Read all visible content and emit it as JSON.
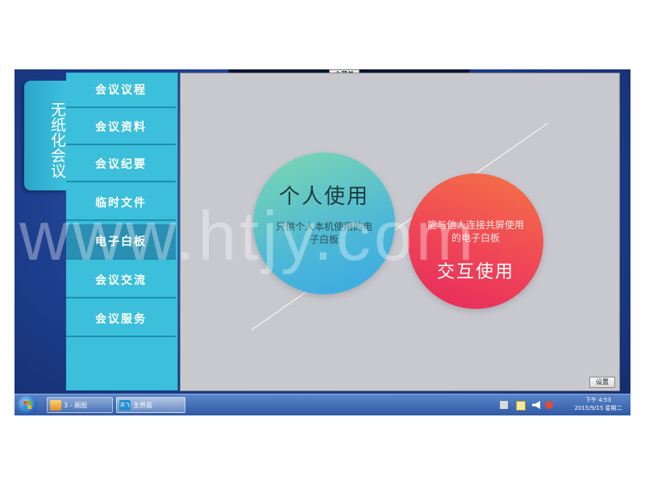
{
  "window": {
    "top_tab_label": "主菜单",
    "settings_label": "设置"
  },
  "app_tab": {
    "label": "无纸化会议"
  },
  "menu": {
    "items": [
      {
        "label": "会议议程",
        "active": false
      },
      {
        "label": "会议资料",
        "active": false
      },
      {
        "label": "会议纪要",
        "active": false
      },
      {
        "label": "临时文件",
        "active": false
      },
      {
        "label": "电子白板",
        "active": true
      },
      {
        "label": "会议交流",
        "active": false
      },
      {
        "label": "会议服务",
        "active": false
      }
    ]
  },
  "main": {
    "personal": {
      "title": "个人使用",
      "description": "只供个人本机使用的电子白板"
    },
    "interactive": {
      "title": "交互使用",
      "description": "能与他人连接共屏使用的电子白板"
    }
  },
  "watermark": "www.htjy.com",
  "taskbar": {
    "items": [
      {
        "label": "3 - 画图",
        "icon": "paint-icon"
      },
      {
        "label": "主界面",
        "badge": "英飞",
        "icon": "app-icon"
      }
    ],
    "clock": {
      "time": "下午 4:53",
      "date": "2015/9/15 星期二"
    }
  },
  "colors": {
    "menu_bg": "#3bbfda",
    "menu_active": "#2b8fb3",
    "content_bg": "#c8c8cf",
    "personal_gradient": [
      "#7ed8b0",
      "#3aa8e6"
    ],
    "interactive_gradient": [
      "#f57545",
      "#e62a5c"
    ],
    "desktop_bg": "#1d3e8d"
  }
}
